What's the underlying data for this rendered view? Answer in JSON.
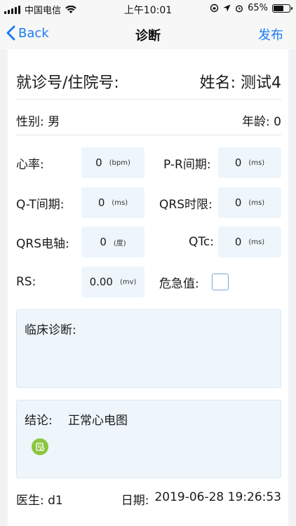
{
  "status_bar": {
    "carrier": "中国电信",
    "time": "上午10:01",
    "battery": "65%",
    "battery_level": 0.65
  },
  "nav": {
    "back_label": "Back",
    "title": "诊断",
    "publish_label": "发布"
  },
  "patient": {
    "id_label": "就诊号/住院号:",
    "name_label": "姓名:",
    "name_value": "测试4",
    "sex_label": "性别:",
    "sex_value": "男",
    "age_label": "年龄:",
    "age_value": "0"
  },
  "params": {
    "heart_rate": {
      "label": "心率:",
      "value": "0",
      "unit": "(bpm)"
    },
    "pr_interval": {
      "label": "P-R间期:",
      "value": "0",
      "unit": "(ms)"
    },
    "qt_interval": {
      "label": "Q-T间期:",
      "value": "0",
      "unit": "(ms)"
    },
    "qrs_duration": {
      "label": "QRS时限:",
      "value": "0",
      "unit": "(ms)"
    },
    "qrs_axis": {
      "label": "QRS电轴:",
      "value": "0",
      "unit": "(度)"
    },
    "qtc": {
      "label": "QTc:",
      "value": "0",
      "unit": "(ms)"
    },
    "rs": {
      "label": "RS:",
      "value": "0.00",
      "unit": "(mv)"
    },
    "critical": {
      "label": "危急值:",
      "checked": false
    }
  },
  "clinical": {
    "label": "临床诊断:",
    "value": ""
  },
  "conclusion": {
    "label": "结论:",
    "value": "正常心电图"
  },
  "footer": {
    "doctor_label": "医生:",
    "doctor_value": "d1",
    "date_label": "日期:",
    "date_value": "2019-06-28 19:26:53"
  },
  "colors": {
    "accent": "#1a7cf5",
    "input_bg": "#eef6fc",
    "sign_icon": "#8cc63f"
  },
  "icons": {
    "back": "chevron-left-icon",
    "signature": "sign-document-icon"
  }
}
